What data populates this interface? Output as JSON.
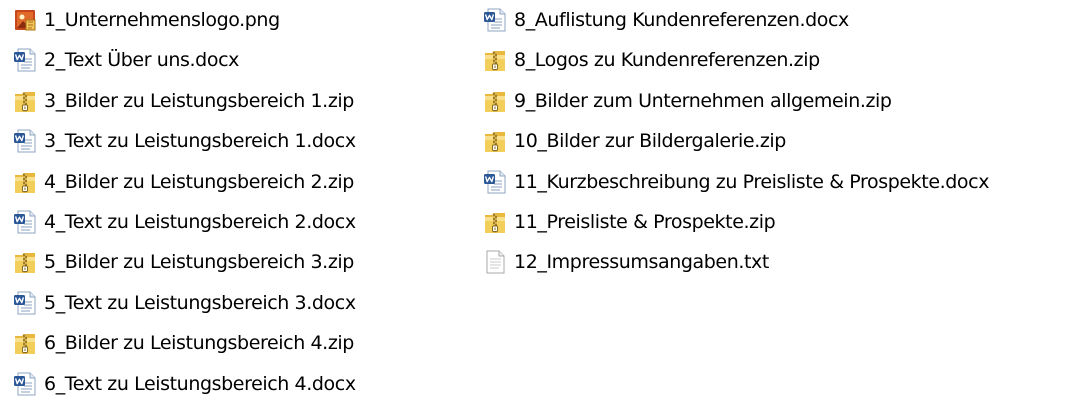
{
  "icons": {
    "png": "image-file-icon",
    "docx": "word-document-icon",
    "zip": "zip-folder-icon",
    "txt": "text-file-icon"
  },
  "colors": {
    "word_blue": "#2b5797",
    "zip_yellow": "#f2cf5b",
    "zip_zipper": "#8a6a1d",
    "image_red": "#c8461e",
    "text_gray": "#cfcfcf"
  },
  "left_column": [
    {
      "name": "1_Unternehmenslogo.png",
      "type": "png"
    },
    {
      "name": "2_Text Über uns.docx",
      "type": "docx"
    },
    {
      "name": "3_Bilder zu Leistungsbereich 1.zip",
      "type": "zip"
    },
    {
      "name": "3_Text zu Leistungsbereich 1.docx",
      "type": "docx"
    },
    {
      "name": "4_Bilder zu Leistungsbereich 2.zip",
      "type": "zip"
    },
    {
      "name": "4_Text zu Leistungsbereich 2.docx",
      "type": "docx"
    },
    {
      "name": "5_Bilder zu Leistungsbereich 3.zip",
      "type": "zip"
    },
    {
      "name": "5_Text zu Leistungsbereich 3.docx",
      "type": "docx"
    },
    {
      "name": "6_Bilder zu Leistungsbereich 4.zip",
      "type": "zip"
    },
    {
      "name": "6_Text zu Leistungsbereich 4.docx",
      "type": "docx"
    }
  ],
  "right_column": [
    {
      "name": "8_Auflistung Kundenreferenzen.docx",
      "type": "docx"
    },
    {
      "name": "8_Logos zu Kundenreferenzen.zip",
      "type": "zip"
    },
    {
      "name": "9_Bilder zum Unternehmen allgemein.zip",
      "type": "zip"
    },
    {
      "name": "10_Bilder zur Bildergalerie.zip",
      "type": "zip"
    },
    {
      "name": "11_Kurzbeschreibung zu Preisliste & Prospekte.docx",
      "type": "docx"
    },
    {
      "name": "11_Preisliste & Prospekte.zip",
      "type": "zip"
    },
    {
      "name": "12_Impressumsangaben.txt",
      "type": "txt"
    }
  ]
}
